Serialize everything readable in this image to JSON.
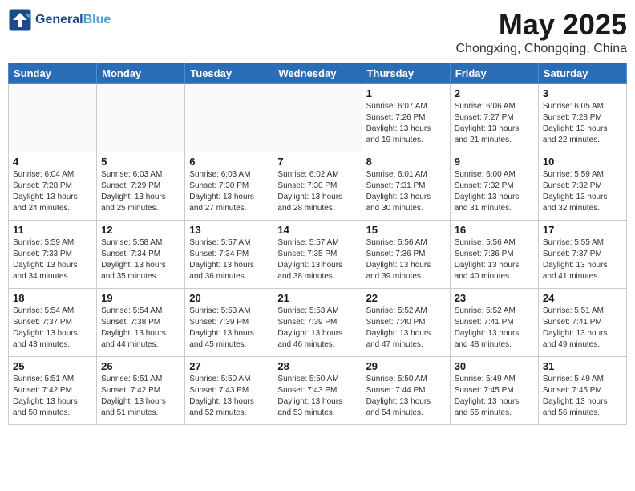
{
  "logo": {
    "line1": "General",
    "line2": "Blue"
  },
  "title": "May 2025",
  "subtitle": "Chongxing, Chongqing, China",
  "days_of_week": [
    "Sunday",
    "Monday",
    "Tuesday",
    "Wednesday",
    "Thursday",
    "Friday",
    "Saturday"
  ],
  "weeks": [
    [
      {
        "day": "",
        "info": ""
      },
      {
        "day": "",
        "info": ""
      },
      {
        "day": "",
        "info": ""
      },
      {
        "day": "",
        "info": ""
      },
      {
        "day": "1",
        "info": "Sunrise: 6:07 AM\nSunset: 7:26 PM\nDaylight: 13 hours\nand 19 minutes."
      },
      {
        "day": "2",
        "info": "Sunrise: 6:06 AM\nSunset: 7:27 PM\nDaylight: 13 hours\nand 21 minutes."
      },
      {
        "day": "3",
        "info": "Sunrise: 6:05 AM\nSunset: 7:28 PM\nDaylight: 13 hours\nand 22 minutes."
      }
    ],
    [
      {
        "day": "4",
        "info": "Sunrise: 6:04 AM\nSunset: 7:28 PM\nDaylight: 13 hours\nand 24 minutes."
      },
      {
        "day": "5",
        "info": "Sunrise: 6:03 AM\nSunset: 7:29 PM\nDaylight: 13 hours\nand 25 minutes."
      },
      {
        "day": "6",
        "info": "Sunrise: 6:03 AM\nSunset: 7:30 PM\nDaylight: 13 hours\nand 27 minutes."
      },
      {
        "day": "7",
        "info": "Sunrise: 6:02 AM\nSunset: 7:30 PM\nDaylight: 13 hours\nand 28 minutes."
      },
      {
        "day": "8",
        "info": "Sunrise: 6:01 AM\nSunset: 7:31 PM\nDaylight: 13 hours\nand 30 minutes."
      },
      {
        "day": "9",
        "info": "Sunrise: 6:00 AM\nSunset: 7:32 PM\nDaylight: 13 hours\nand 31 minutes."
      },
      {
        "day": "10",
        "info": "Sunrise: 5:59 AM\nSunset: 7:32 PM\nDaylight: 13 hours\nand 32 minutes."
      }
    ],
    [
      {
        "day": "11",
        "info": "Sunrise: 5:59 AM\nSunset: 7:33 PM\nDaylight: 13 hours\nand 34 minutes."
      },
      {
        "day": "12",
        "info": "Sunrise: 5:58 AM\nSunset: 7:34 PM\nDaylight: 13 hours\nand 35 minutes."
      },
      {
        "day": "13",
        "info": "Sunrise: 5:57 AM\nSunset: 7:34 PM\nDaylight: 13 hours\nand 36 minutes."
      },
      {
        "day": "14",
        "info": "Sunrise: 5:57 AM\nSunset: 7:35 PM\nDaylight: 13 hours\nand 38 minutes."
      },
      {
        "day": "15",
        "info": "Sunrise: 5:56 AM\nSunset: 7:36 PM\nDaylight: 13 hours\nand 39 minutes."
      },
      {
        "day": "16",
        "info": "Sunrise: 5:56 AM\nSunset: 7:36 PM\nDaylight: 13 hours\nand 40 minutes."
      },
      {
        "day": "17",
        "info": "Sunrise: 5:55 AM\nSunset: 7:37 PM\nDaylight: 13 hours\nand 41 minutes."
      }
    ],
    [
      {
        "day": "18",
        "info": "Sunrise: 5:54 AM\nSunset: 7:37 PM\nDaylight: 13 hours\nand 43 minutes."
      },
      {
        "day": "19",
        "info": "Sunrise: 5:54 AM\nSunset: 7:38 PM\nDaylight: 13 hours\nand 44 minutes."
      },
      {
        "day": "20",
        "info": "Sunrise: 5:53 AM\nSunset: 7:39 PM\nDaylight: 13 hours\nand 45 minutes."
      },
      {
        "day": "21",
        "info": "Sunrise: 5:53 AM\nSunset: 7:39 PM\nDaylight: 13 hours\nand 46 minutes."
      },
      {
        "day": "22",
        "info": "Sunrise: 5:52 AM\nSunset: 7:40 PM\nDaylight: 13 hours\nand 47 minutes."
      },
      {
        "day": "23",
        "info": "Sunrise: 5:52 AM\nSunset: 7:41 PM\nDaylight: 13 hours\nand 48 minutes."
      },
      {
        "day": "24",
        "info": "Sunrise: 5:51 AM\nSunset: 7:41 PM\nDaylight: 13 hours\nand 49 minutes."
      }
    ],
    [
      {
        "day": "25",
        "info": "Sunrise: 5:51 AM\nSunset: 7:42 PM\nDaylight: 13 hours\nand 50 minutes."
      },
      {
        "day": "26",
        "info": "Sunrise: 5:51 AM\nSunset: 7:42 PM\nDaylight: 13 hours\nand 51 minutes."
      },
      {
        "day": "27",
        "info": "Sunrise: 5:50 AM\nSunset: 7:43 PM\nDaylight: 13 hours\nand 52 minutes."
      },
      {
        "day": "28",
        "info": "Sunrise: 5:50 AM\nSunset: 7:43 PM\nDaylight: 13 hours\nand 53 minutes."
      },
      {
        "day": "29",
        "info": "Sunrise: 5:50 AM\nSunset: 7:44 PM\nDaylight: 13 hours\nand 54 minutes."
      },
      {
        "day": "30",
        "info": "Sunrise: 5:49 AM\nSunset: 7:45 PM\nDaylight: 13 hours\nand 55 minutes."
      },
      {
        "day": "31",
        "info": "Sunrise: 5:49 AM\nSunset: 7:45 PM\nDaylight: 13 hours\nand 56 minutes."
      }
    ]
  ]
}
